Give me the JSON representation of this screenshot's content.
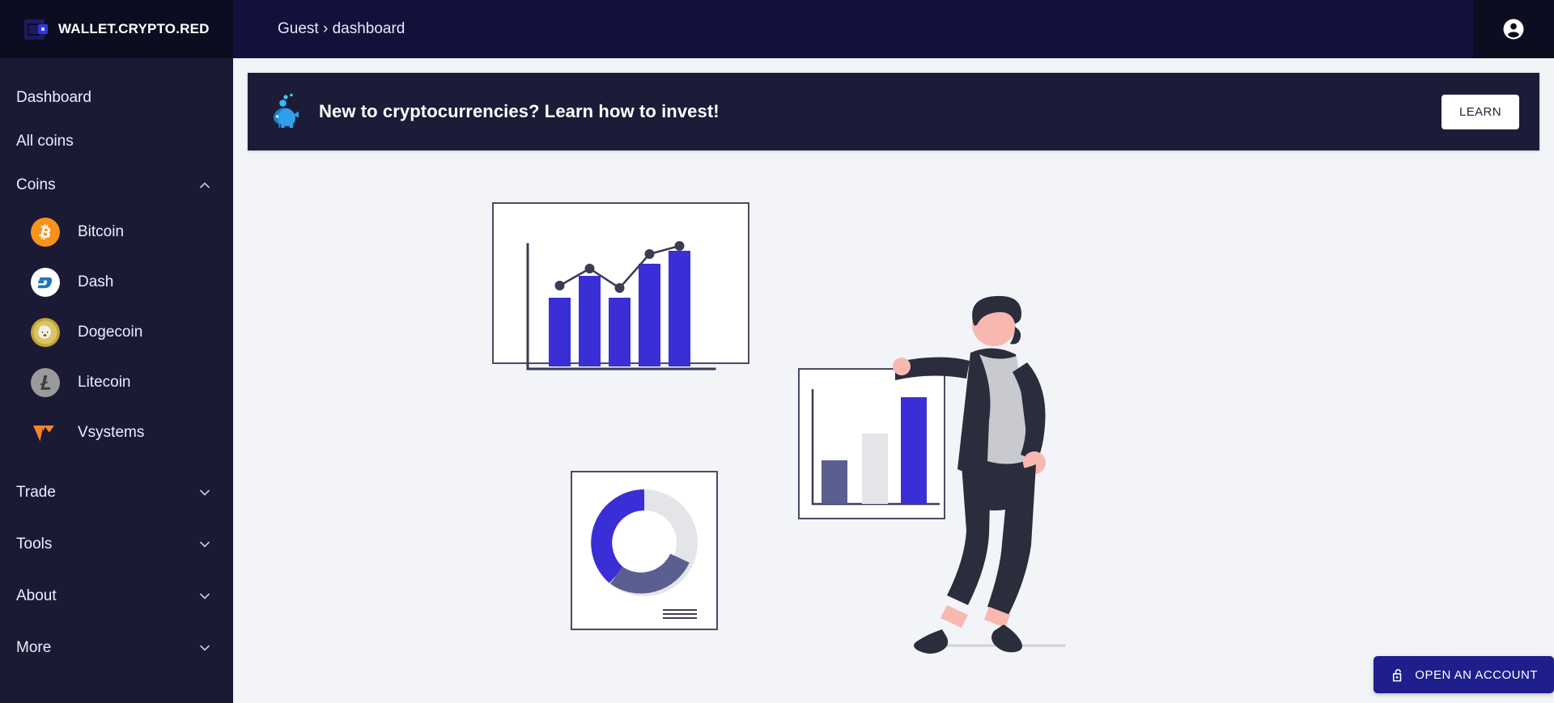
{
  "topbar": {
    "brand_name": "WALLET.CRYPTO.RED",
    "breadcrumb": "Guest › dashboard",
    "account_icon": "account-circle-icon"
  },
  "sidebar": {
    "items": [
      {
        "label": "Dashboard",
        "icon": null,
        "expandable": false
      },
      {
        "label": "All coins",
        "icon": null,
        "expandable": false
      },
      {
        "label": "Coins",
        "icon": "chevron-up-icon",
        "expandable": true,
        "expanded": true
      }
    ],
    "coins": [
      {
        "label": "Bitcoin",
        "icon": "bitcoin-icon",
        "color": "#f7931a"
      },
      {
        "label": "Dash",
        "icon": "dash-icon",
        "color": "#1c75bc"
      },
      {
        "label": "Dogecoin",
        "icon": "dogecoin-icon",
        "color": "#c2a633"
      },
      {
        "label": "Litecoin",
        "icon": "litecoin-icon",
        "color": "#8f8f8f"
      },
      {
        "label": "Vsystems",
        "icon": "vsystems-icon",
        "color": "#f5842a"
      }
    ],
    "groups": [
      {
        "label": "Trade",
        "icon": "chevron-down-icon",
        "expanded": false
      },
      {
        "label": "Tools",
        "icon": "chevron-down-icon",
        "expanded": false
      },
      {
        "label": "About",
        "icon": "chevron-down-icon",
        "expanded": false
      },
      {
        "label": "More",
        "icon": "chevron-down-icon",
        "expanded": false
      }
    ]
  },
  "banner": {
    "icon": "piggy-bank-icon",
    "message": "New to cryptocurrencies? Learn how to invest!",
    "button_label": "LEARN"
  },
  "cta": {
    "icon": "unlock-padlock-icon",
    "label": "OPEN AN ACCOUNT"
  },
  "colors": {
    "topbar_bg": "#0d0d22",
    "breadcrumb_bg": "#11113b",
    "sidebar_bg": "#1a1a35",
    "page_bg": "#f3f4f7",
    "banner_bg": "#1c1c38",
    "accent_blue": "#3a2fd6",
    "cta_bg": "#1e1e8c",
    "illus_dark": "#2b2c3c",
    "illus_grey": "#e4e5e9",
    "illus_muted_blue": "#5a5f8f",
    "illus_skin": "#f8b8b0"
  },
  "illustration": {
    "name": "investor-with-charts-illustration",
    "charts": [
      {
        "name": "bar-line-chart-card",
        "type": "bar",
        "bars": [
          38,
          62,
          38,
          80,
          100
        ],
        "line_points": [
          30,
          62,
          28,
          84,
          96
        ]
      },
      {
        "name": "bar-chart-card",
        "type": "bar",
        "bars": [
          40,
          62,
          100
        ],
        "bar_colors": [
          "#5a5f8f",
          "#e4e5e9",
          "#3a2fd6"
        ]
      },
      {
        "name": "donut-chart-card",
        "type": "pie",
        "slices": [
          {
            "value": 35,
            "color": "#3a2fd6"
          },
          {
            "value": 20,
            "color": "#5a5f8f"
          },
          {
            "value": 45,
            "color": "#e4e5e9"
          }
        ]
      }
    ]
  }
}
